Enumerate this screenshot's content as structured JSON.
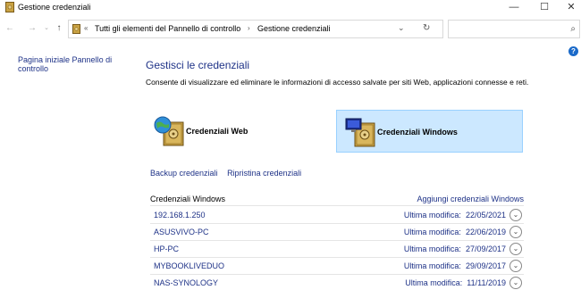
{
  "window": {
    "title": "Gestione credenziali",
    "controls": {
      "minimize": "—",
      "maximize": "☐",
      "close": "✕"
    }
  },
  "nav": {
    "back": "←",
    "forward": "→",
    "history": "⌄",
    "up": "↑",
    "breadcrumb_sep0": "«",
    "breadcrumb": [
      "Tutti gli elementi del Pannello di controllo",
      "Gestione credenziali"
    ],
    "breadcrumb_sep": "›",
    "dropdown": "⌄",
    "refresh": "↻",
    "search_placeholder": "",
    "search_icon": "⌕"
  },
  "sidebar": {
    "home_link": "Pagina iniziale Pannello di controllo"
  },
  "help_icon": "?",
  "main": {
    "title": "Gestisci le credenziali",
    "description": "Consente di visualizzare ed eliminare le informazioni di accesso salvate per siti Web, applicazioni connesse e reti.",
    "tiles": [
      {
        "label": "Credenziali Web",
        "icon": "globe-vault-icon",
        "selected": false
      },
      {
        "label": "Credenziali Windows",
        "icon": "monitor-vault-icon",
        "selected": true
      }
    ],
    "backup_link": "Backup credenziali",
    "restore_link": "Ripristina credenziali",
    "list": {
      "header": "Credenziali Windows",
      "add_link": "Aggiungi credenziali Windows",
      "modified_label": "Ultima modifica:",
      "items": [
        {
          "name": "192.168.1.250",
          "modified": "22/05/2021"
        },
        {
          "name": "ASUSVIVO-PC",
          "modified": "22/06/2019"
        },
        {
          "name": "HP-PC",
          "modified": "27/09/2017"
        },
        {
          "name": "MYBOOKLIVEDUO",
          "modified": "29/09/2017"
        },
        {
          "name": "NAS-SYNOLOGY",
          "modified": "11/11/2019"
        }
      ]
    }
  },
  "colors": {
    "link": "#1e3287",
    "selected_tile_bg": "#cce8ff",
    "selected_tile_border": "#99d1ff"
  }
}
